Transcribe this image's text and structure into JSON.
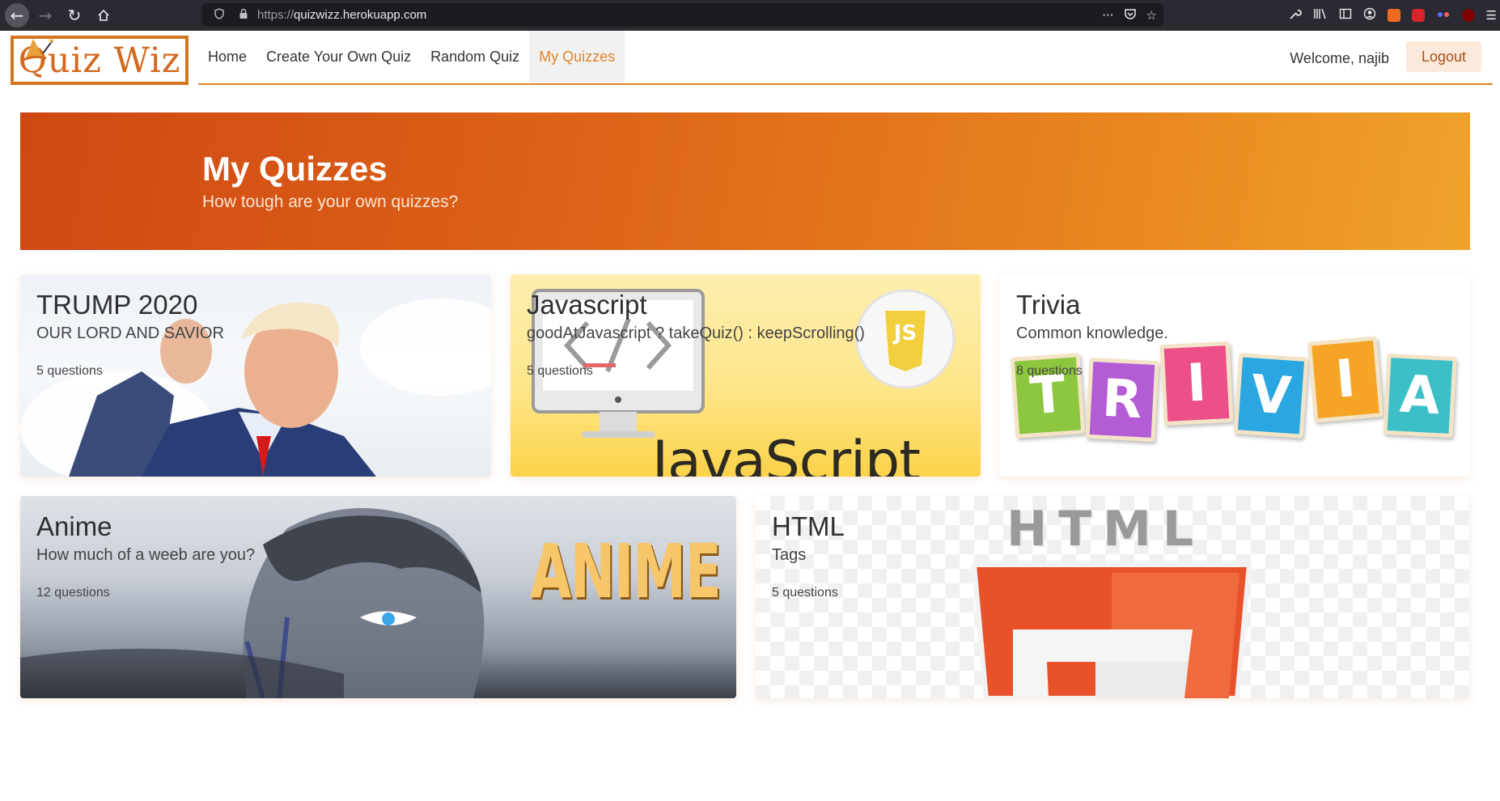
{
  "browser": {
    "url_scheme": "https://",
    "url_host": "quizwizz.herokuapp.com",
    "page_actions_icon": "···"
  },
  "header": {
    "logo_text": "Quiz Wiz",
    "nav": [
      {
        "label": "Home",
        "active": false
      },
      {
        "label": "Create Your Own Quiz",
        "active": false
      },
      {
        "label": "Random Quiz",
        "active": false
      },
      {
        "label": "My Quizzes",
        "active": true
      }
    ],
    "welcome": "Welcome, najib",
    "logout_label": "Logout"
  },
  "hero": {
    "title": "My Quizzes",
    "subtitle": "How tough are your own quizzes?"
  },
  "quizzes": [
    {
      "title": "TRUMP 2020",
      "subtitle": "OUR LORD AND SAVIOR",
      "count": "5 questions"
    },
    {
      "title": "Javascript",
      "subtitle": "goodAtJavascript ? takeQuiz() : keepScrolling()",
      "count": "5 questions",
      "art_text": "JavaScript",
      "badge_text": "JS"
    },
    {
      "title": "Trivia",
      "subtitle": "Common knowledge.",
      "count": "8 questions",
      "art_letters": [
        "T",
        "R",
        "I",
        "V",
        "I",
        "A"
      ]
    },
    {
      "title": "Anime",
      "subtitle": "How much of a weeb are you?",
      "count": "12 questions",
      "art_text": "ANIME"
    },
    {
      "title": "HTML",
      "subtitle": "Tags",
      "count": "5 questions",
      "art_text": "HTML"
    }
  ],
  "colors": {
    "accent": "#e2822a",
    "logo": "#d2691e",
    "hero_start": "#cf4813",
    "hero_end": "#efa32b",
    "logout_bg": "#fbe9dc"
  }
}
